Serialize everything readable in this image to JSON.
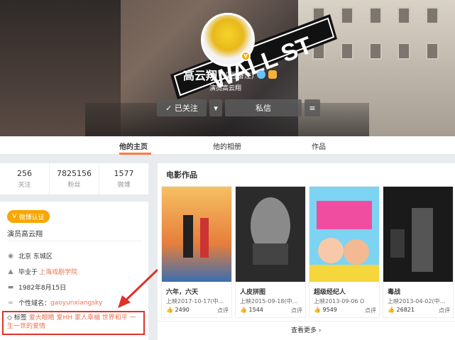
{
  "profile": {
    "name": "高云翔",
    "remark": "(设置备注)",
    "tagline": "演员高云翔",
    "follow_label": "✓ 已关注",
    "message_label": "私信",
    "sign_text": "WALL ST"
  },
  "tabs": [
    {
      "label": "他的主页",
      "active": true
    },
    {
      "label": "他的相册",
      "active": false
    },
    {
      "label": "作品",
      "active": false
    }
  ],
  "stats": [
    {
      "num": "256",
      "label": "关注"
    },
    {
      "num": "7825156",
      "label": "粉丝"
    },
    {
      "num": "1577",
      "label": "微博"
    }
  ],
  "info": {
    "verify_label": "微博认证",
    "verify_title": "演员高云翔",
    "location": "北京 东城区",
    "school_prefix": "毕业于",
    "school": "上海戏剧学院",
    "birthday": "1982年8月15日",
    "domain_prefix": "个性域名：",
    "domain": "gaoyunxiangsky",
    "tags_prefix": "标签",
    "tags": "爱大眼睛 爱HH 家人幸福 世界和平 一生一世的爱情"
  },
  "movies": {
    "section_title": "电影作品",
    "more_label": "查看更多 ›",
    "items": [
      {
        "title": "六年，六天",
        "date": "上映2017-10-17(中...",
        "likes": "2490",
        "comment": "点评"
      },
      {
        "title": "人皮拼图",
        "date": "上映2015-09-18(中...",
        "likes": "1544",
        "comment": "点评"
      },
      {
        "title": "超级经纪人",
        "date": "上映2013-09-06 O",
        "likes": "9549",
        "comment": "点评"
      },
      {
        "title": "毒战",
        "date": "上映2013-04-02(中...",
        "likes": "26821",
        "comment": "点评"
      }
    ]
  },
  "colors": {
    "accent": "#fa7d3c",
    "link": "#eb7350",
    "verify": "#f7a700",
    "highlight": "#e0312a"
  }
}
